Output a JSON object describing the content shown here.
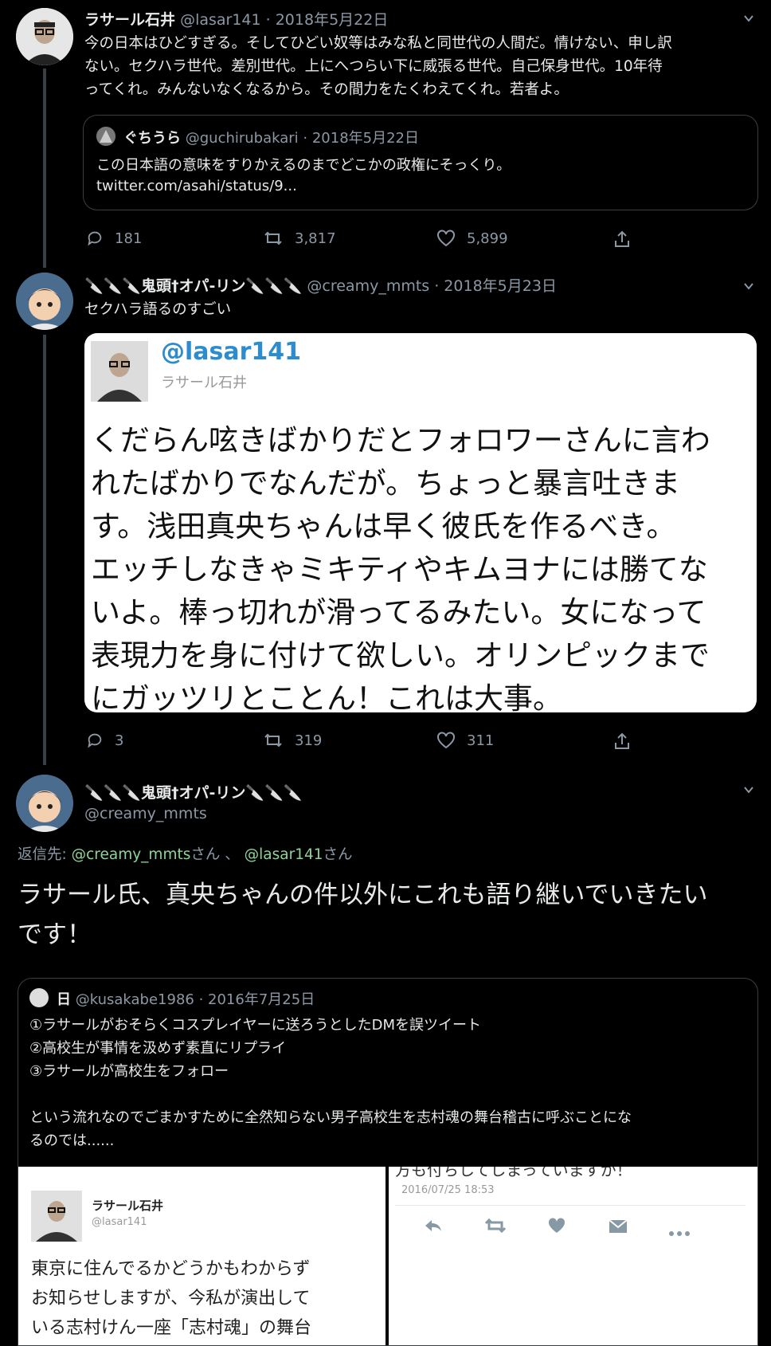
{
  "tweet1": {
    "name": "ラサール石井",
    "handle_date": "@lasar141 · 2018年5月22日",
    "lines": [
      "今の日本はひどすぎる。そしてひどい奴等はみな私と同世代の人間だ。情けない、申し訳",
      "ない。セクハラ世代。差別世代。上にへつらい下に威張る世代。自己保身世代。10年待",
      "ってくれ。みんないなくなるから。その間力をたくわえてくれ。若者よ。"
    ],
    "quote": {
      "name": "ぐちうら",
      "handle_date": "@guchirubakari · 2018年5月22日",
      "text": "この日本語の意味をすりかえるのまでどこかの政権にそっくり。",
      "link": "twitter.com/asahi/status/9..."
    },
    "replies": "181",
    "retweets": "3,817",
    "likes": "5,899"
  },
  "tweet2": {
    "name": "🔪🔪🔪鬼頭†オパ-リン🔪🔪🔪",
    "handle_date": "@creamy_mmts · 2018年5月23日",
    "text": "セクハラ語るのすごい",
    "image": {
      "handle": "@lasar141",
      "name": "ラサール石井",
      "lines": [
        "くだらん呟きばかりだとフォロワーさんに言わ",
        "れたばかりでなんだが。ちょっと暴言吐きま",
        "す。浅田真央ちゃんは早く彼氏を作るべき。",
        "エッチしなきゃミキティやキムヨナには勝てな",
        "いよ。棒っ切れが滑ってるみたい。女になって",
        "表現力を身に付けて欲しい。オリンピックまで",
        "にガッツリとことん！これは大事。"
      ]
    },
    "replies": "3",
    "retweets": "319",
    "likes": "311"
  },
  "tweet3": {
    "name": "🔪🔪🔪鬼頭†オパ-リン🔪🔪🔪",
    "handle": "@creamy_mmts",
    "reply_prefix": "返信先: ",
    "reply_user1": "@creamy_mmts",
    "san1": "さん 、 ",
    "reply_user2": "@lasar141",
    "san2": "さん",
    "lines": [
      "ラサール氏、真央ちゃんの件以外にこれも語り継いでいきたい",
      "です！"
    ],
    "quote": {
      "name": "日",
      "handle_date": "@kusakabe1986 · 2016年7月25日",
      "lines": [
        "①ラサールがおそらくコスプレイヤーに送ろうとしたDMを誤ツイート",
        "②高校生が事情を汲めず素直にリプライ",
        "③ラサールが高校生をフォロー",
        "",
        "という流れなのでごまかすために全然知らない男子高校生を志村魂の舞台稽古に呼ぶことにな",
        "るのでは......"
      ],
      "left_img": {
        "name": "ラサール石井",
        "handle": "@lasar141",
        "lines": [
          "東京に住んでるかどうかもわからず",
          "お知らせしますが、今私が演出して",
          "いる志村けん一座「志村魂」の舞台"
        ]
      },
      "right_img": {
        "top_text": "方も付ちしてしまっていますか！",
        "timestamp": "2016/07/25 18:53"
      }
    }
  },
  "colors": {
    "background": "#000000",
    "text": "#e7e9ea",
    "secondary": "#8b98a5",
    "reply_link": "#8ed49a",
    "image_handle": "#2d8ccd"
  }
}
